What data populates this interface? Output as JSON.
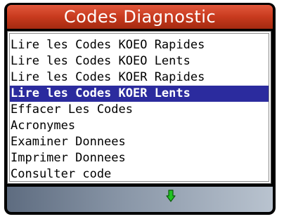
{
  "header": {
    "title": "Codes Diagnostic"
  },
  "menu": {
    "items": [
      {
        "label": "Lire les Codes KOEO Rapides",
        "selected": false
      },
      {
        "label": "Lire les Codes KOEO Lents",
        "selected": false
      },
      {
        "label": "Lire les Codes KOER Rapides",
        "selected": false
      },
      {
        "label": "Lire les Codes KOER Lents",
        "selected": true
      },
      {
        "label": "Effacer Les Codes",
        "selected": false
      },
      {
        "label": "Acronymes",
        "selected": false
      },
      {
        "label": "Examiner Donnees",
        "selected": false
      },
      {
        "label": "Imprimer Donnees",
        "selected": false
      },
      {
        "label": "Consulter code",
        "selected": false
      }
    ]
  },
  "footer": {
    "icon": "down-arrow-icon",
    "icon_color": "#22c322"
  },
  "colors": {
    "title_bar": "#c83a1e",
    "selection": "#2b2b9e"
  }
}
